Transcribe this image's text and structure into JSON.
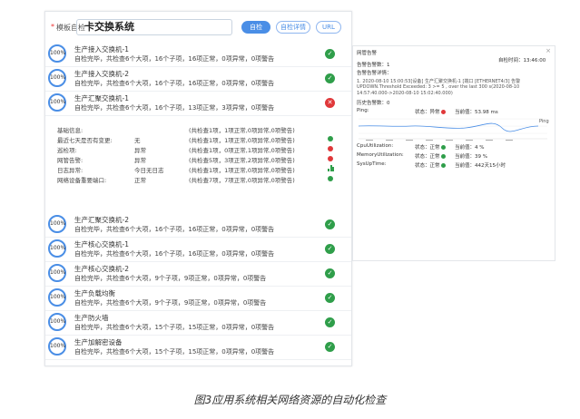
{
  "search": {
    "label": "模板自检",
    "value": "卡交换系统",
    "buttons": {
      "check": "自检",
      "detail": "自检详情",
      "url": "URL"
    }
  },
  "items_top": [
    {
      "progress": "100%",
      "title": "生产接入交换机-1",
      "summary": "自检完毕，共检查6个大项，16个子项，16项正常，0项异常，0项警告",
      "status": "ok"
    },
    {
      "progress": "100%",
      "title": "生产接入交换机-2",
      "summary": "自检完毕，共检查6个大项，16个子项，16项正常，0项异常，0项警告",
      "status": "ok"
    },
    {
      "progress": "100%",
      "title": "生产汇聚交换机-1",
      "summary": "自检完毕，共检查6个大项，16个子项，13项正常，3项异常，0项警告",
      "status": "error"
    }
  ],
  "details": [
    {
      "label": "基础信息:",
      "value": "",
      "summary": "(共检查1项，1项正常,0项异常,0项警告)",
      "icon": ""
    },
    {
      "label": "最近七天是否有变更:",
      "value": "无",
      "summary": "(共检查1项，1项正常,0项异常,0项警告)",
      "icon": "ok"
    },
    {
      "label": "巡检项:",
      "value": "异常",
      "summary": "(共检查1项，0项正常,1项异常,0项警告)",
      "icon": "error"
    },
    {
      "label": "网管告警:",
      "value": "异常",
      "summary": "(共检查5项，3项正常,2项异常,0项警告)",
      "icon": "error"
    },
    {
      "label": "日志异常:",
      "value": "今日无日志",
      "summary": "(共检查1项，1项正常,0项异常,0项警告)",
      "icon": "bar"
    },
    {
      "label": "网络设备重要端口:",
      "value": "正常",
      "summary": "(共检查7项，7项正常,0项异常,0项警告)",
      "icon": "ok"
    }
  ],
  "items_bottom": [
    {
      "progress": "100%",
      "title": "生产汇聚交换机-2",
      "summary": "自检完毕，共检查6个大项，16个子项，16项正常，0项异常，0项警告",
      "status": "ok"
    },
    {
      "progress": "100%",
      "title": "生产核心交换机-1",
      "summary": "自检完毕，共检查6个大项，16个子项，16项正常，0项异常，0项警告",
      "status": "ok"
    },
    {
      "progress": "100%",
      "title": "生产核心交换机-2",
      "summary": "自检完毕，共检查6个大项，9个子项，9项正常，0项异常，0项警告",
      "status": "ok"
    },
    {
      "progress": "100%",
      "title": "生产负载均衡",
      "summary": "自检完毕，共检查6个大项，9个子项，9项正常，0项异常，0项警告",
      "status": "ok"
    },
    {
      "progress": "100%",
      "title": "生产防火墙",
      "summary": "自检完毕，共检查6个大项，15个子项，15项正常，0项异常，0项警告",
      "status": "ok"
    },
    {
      "progress": "100%",
      "title": "生产加解密设备",
      "summary": "自检完毕，共检查6个大项，15个子项，15项正常，0项异常，0项警告",
      "status": "ok"
    }
  ],
  "side_panel": {
    "title": "网管告警",
    "time_label": "自检时间：13:46:00",
    "alarm_count": "告警告警数：1",
    "alarm_detail_label": "告警告警详情：",
    "alarm_line1": "1. 2020-08-10 15:00:53[设备] 生产汇聚交换机-1 [端口 [ETHERNET4/3] 告警",
    "alarm_line2": "UPDOWN.Threshold Exceeded: 3 >= 5 , over the last 300 s(2020-08-10",
    "alarm_line3": "14:57:40.000->2020-08-10 15:02:40.000)",
    "history_alarm": "历史告警数：0",
    "ping_label": "Ping:",
    "ping_status": "状态：异常",
    "ping_value": "当前值：53.98 ms",
    "ping_legend": "Ping",
    "metrics": [
      {
        "name": "CpuUtilization:",
        "status": "状态：正常",
        "value": "当前值：4 %"
      },
      {
        "name": "MemoryUtilization:",
        "status": "状态：正常",
        "value": "当前值：39 %"
      },
      {
        "name": "SysUpTime:",
        "status": "状态：正常",
        "value": "当前值：442天15小时"
      }
    ]
  },
  "caption": "图3应用系统相关网络资源的自动化检查"
}
